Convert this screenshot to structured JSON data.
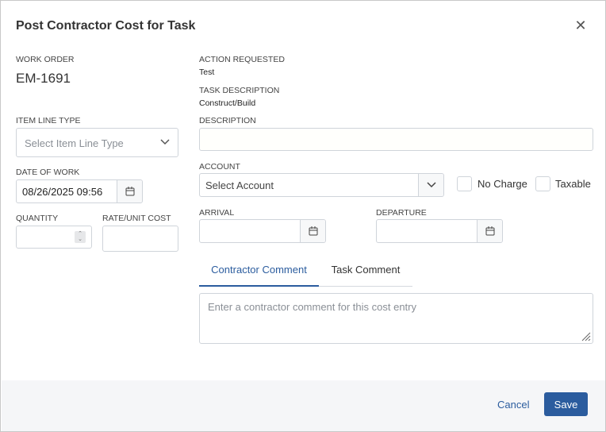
{
  "dialog": {
    "title": "Post Contractor Cost for Task",
    "close_icon": "close-icon"
  },
  "work_order": {
    "label": "WORK ORDER",
    "value": "EM-1691"
  },
  "action_requested": {
    "label": "ACTION REQUESTED",
    "value": "Test"
  },
  "task_description": {
    "label": "TASK DESCRIPTION",
    "value": "Construct/Build"
  },
  "item_line_type": {
    "label": "ITEM LINE TYPE",
    "placeholder": "Select Item Line Type"
  },
  "description": {
    "label": "DESCRIPTION",
    "value": ""
  },
  "date_of_work": {
    "label": "DATE OF WORK",
    "value": "08/26/2025 09:56"
  },
  "account": {
    "label": "ACCOUNT",
    "placeholder": "Select Account"
  },
  "no_charge": {
    "label": "No Charge",
    "checked": false
  },
  "taxable": {
    "label": "Taxable",
    "checked": false
  },
  "quantity": {
    "label": "QUANTITY",
    "value": ""
  },
  "rate": {
    "label": "RATE/UNIT COST",
    "value": ""
  },
  "arrival": {
    "label": "ARRIVAL",
    "value": ""
  },
  "departure": {
    "label": "DEPARTURE",
    "value": ""
  },
  "tabs": [
    {
      "label": "Contractor Comment",
      "active": true
    },
    {
      "label": "Task Comment",
      "active": false
    }
  ],
  "comment": {
    "placeholder": "Enter a contractor comment for this cost entry"
  },
  "footer": {
    "cancel": "Cancel",
    "save": "Save"
  },
  "colors": {
    "accent": "#2b5c9e"
  }
}
